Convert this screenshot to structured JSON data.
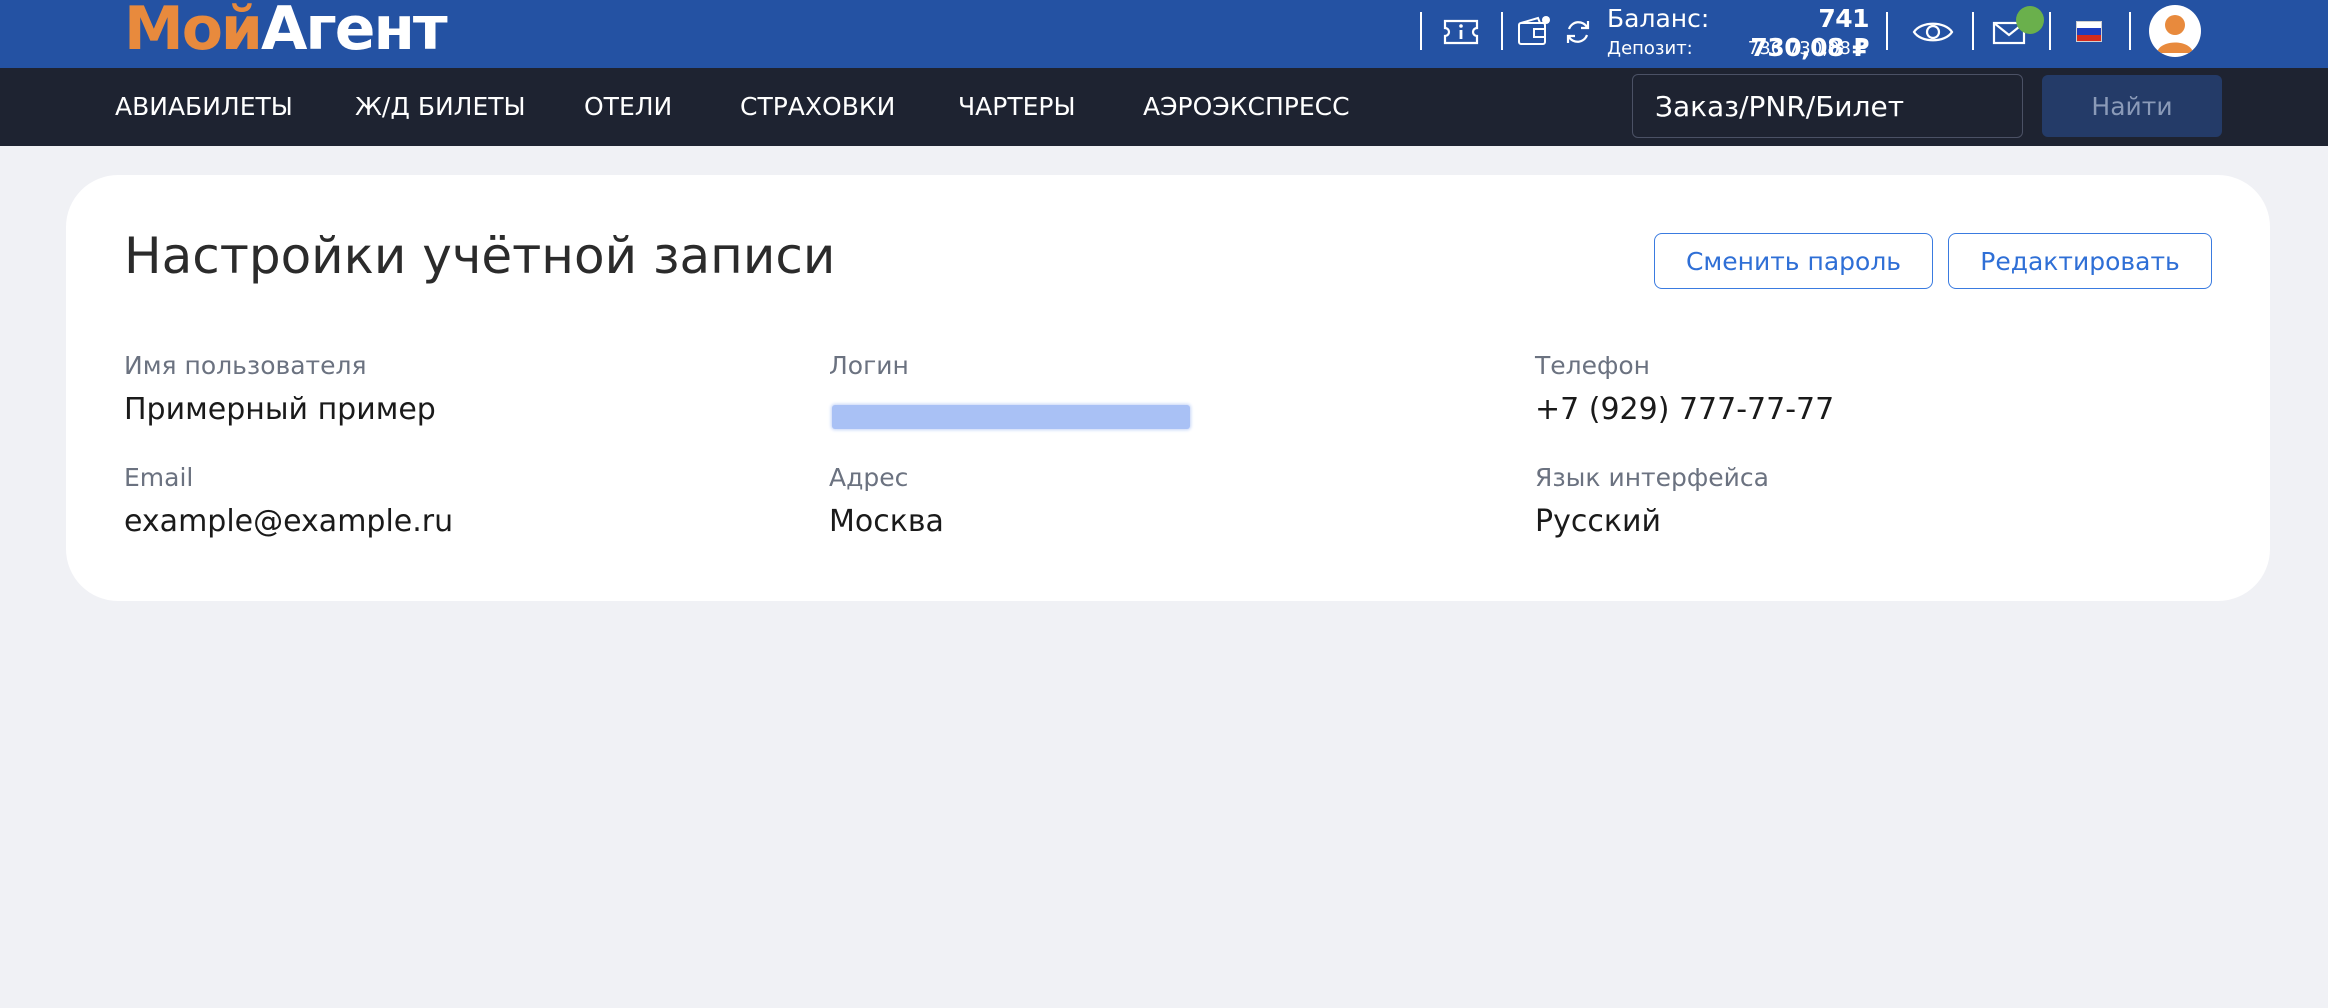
{
  "header": {
    "logo_part1": "Мой",
    "logo_part2": "Агент",
    "balance_label": "Баланс:",
    "balance_value": "741 730,08 ₽",
    "deposit_label": "Депозит:",
    "deposit_value": "736 730,08 ₽",
    "icons": [
      "info-ticket-icon",
      "wallet-icon",
      "refresh-icon",
      "eye-icon",
      "mail-icon",
      "russia-flag-icon",
      "user-avatar-icon"
    ],
    "colors": {
      "bar": "#2452a3",
      "logo_accent": "#e88a3d",
      "badge": "#6ab04c"
    }
  },
  "nav": {
    "items": [
      {
        "label": "АВИАБИЛЕТЫ"
      },
      {
        "label": "Ж/Д БИЛЕТЫ"
      },
      {
        "label": "ОТЕЛИ"
      },
      {
        "label": "СТРАХОВКИ"
      },
      {
        "label": "ЧАРТЕРЫ"
      },
      {
        "label": "АЭРОЭКСПРЕСС"
      }
    ],
    "search_placeholder": "Заказ/PNR/Билет",
    "search_button": "Найти",
    "colors": {
      "bar": "#1e2331",
      "button": "#243b68"
    }
  },
  "account": {
    "title": "Настройки учётной записи",
    "change_password_button": "Сменить пароль",
    "edit_button": "Редактировать",
    "fields": {
      "username": {
        "label": "Имя пользователя",
        "value": "Примерный пример"
      },
      "login": {
        "label": "Логин",
        "value": ""
      },
      "phone": {
        "label": "Телефон",
        "value": "+7 (929) 777-77-77"
      },
      "email": {
        "label": "Email",
        "value": "example@example.ru"
      },
      "address": {
        "label": "Адрес",
        "value": "Москва"
      },
      "language": {
        "label": "Язык интерфейса",
        "value": "Русский"
      }
    },
    "colors": {
      "accent": "#2f6fd6",
      "redaction": "#a9c1f5"
    }
  }
}
